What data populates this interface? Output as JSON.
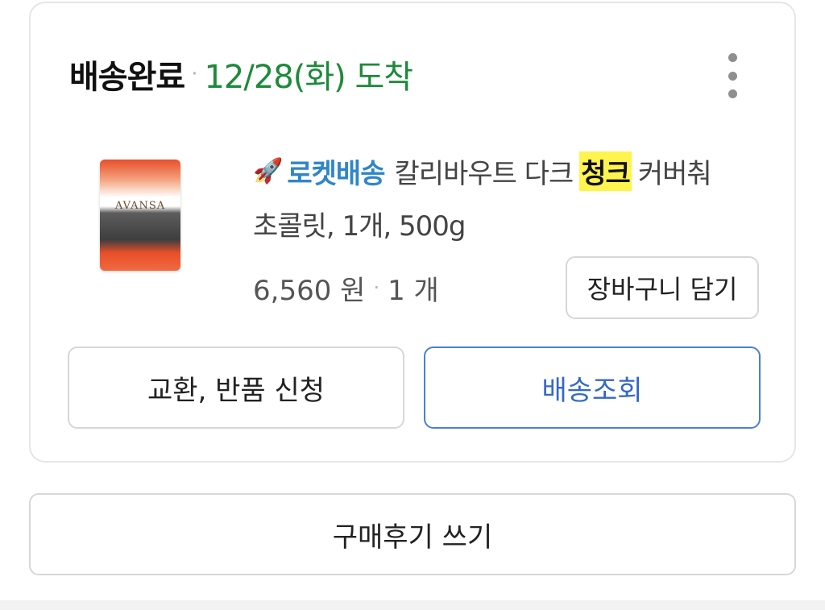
{
  "order": {
    "status": "배송완료",
    "separator": "·",
    "arrival": "12/28(화) 도착",
    "more_icon": "more-vertical-icon"
  },
  "product": {
    "image_icon": "chocolate-package-image",
    "image_label": "AVANSA",
    "delivery_icon": "rocket-icon",
    "delivery_badge": "로켓배송",
    "name_part1": "칼리바우트 다크",
    "name_highlight": "청크",
    "name_part2": "커버춰",
    "name_line2": "초콜릿, 1개, 500g",
    "price": "6,560 원",
    "separator": "·",
    "quantity": "1 개"
  },
  "buttons": {
    "add_to_cart": "장바구니 담기",
    "exchange_return": "교환, 반품 신청",
    "track_delivery": "배송조회",
    "write_review": "구매후기 쓰기"
  },
  "colors": {
    "arrival_green": "#1d8a3a",
    "rocket_blue": "#2f86c9",
    "highlight_yellow": "#fff34d",
    "track_button_blue": "#3468c8"
  }
}
